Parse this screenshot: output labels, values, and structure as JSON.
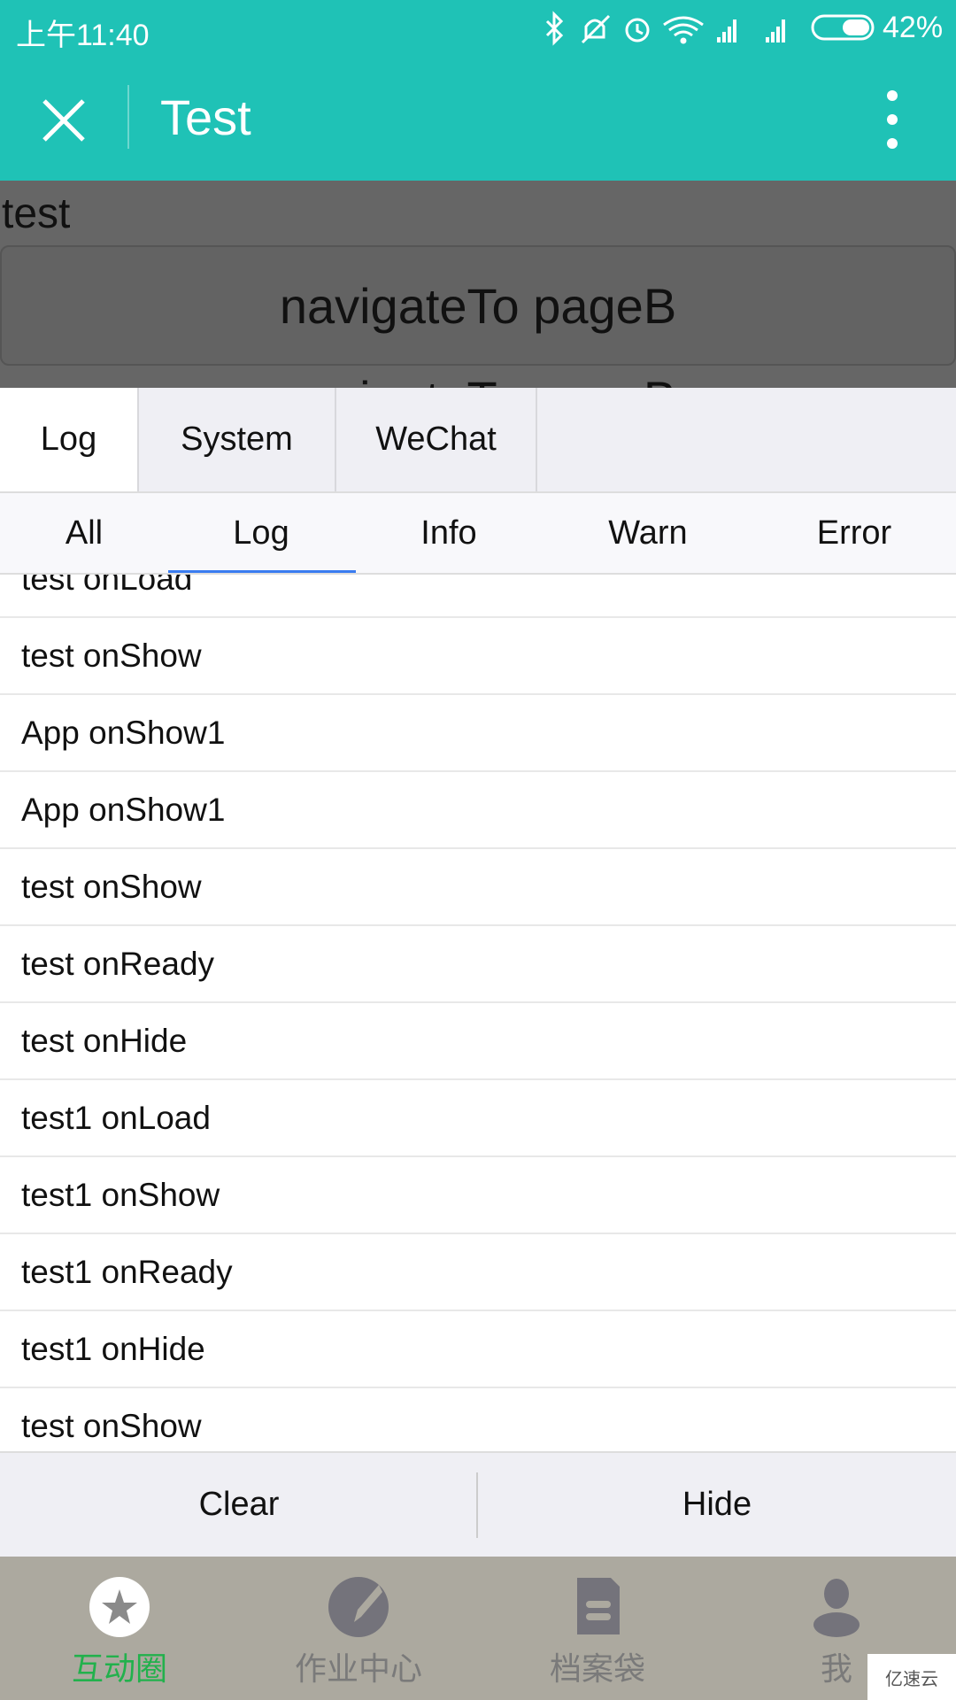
{
  "status_bar": {
    "time": "上午11:40",
    "battery": "42%",
    "icons": [
      "bluetooth-icon",
      "mute-icon",
      "alarm-icon",
      "wifi-icon",
      "signal-icon",
      "signal-icon",
      "battery-icon"
    ]
  },
  "nav": {
    "title": "Test",
    "close_icon": "close-icon",
    "menu_icon": "more-vertical-icon"
  },
  "page": {
    "text": "test",
    "button1": "navigateTo pageB",
    "button2": "navigateTo pageB"
  },
  "console": {
    "tabs": [
      {
        "label": "Log",
        "active": true
      },
      {
        "label": "System"
      },
      {
        "label": "WeChat"
      }
    ],
    "filters": [
      {
        "label": "All"
      },
      {
        "label": "Log",
        "active": true
      },
      {
        "label": "Info"
      },
      {
        "label": "Warn"
      },
      {
        "label": "Error"
      }
    ],
    "accent": "#3a7cf0",
    "logs": [
      "test onLoad",
      "test onShow",
      "App onShow1",
      "App onShow1",
      "test onShow",
      "test onReady",
      "test onHide",
      "test1 onLoad",
      "test1 onShow",
      "test1 onReady",
      "test1 onHide",
      "test onShow"
    ],
    "clear": "Clear",
    "hide": "Hide"
  },
  "tabbar": {
    "items": [
      {
        "label": "互动圈",
        "icon": "star-icon",
        "active": true
      },
      {
        "label": "作业中心",
        "icon": "pencil-icon"
      },
      {
        "label": "档案袋",
        "icon": "document-icon"
      },
      {
        "label": "我",
        "icon": "person-icon"
      }
    ],
    "active_color": "#22b14c"
  },
  "watermark": "亿速云"
}
